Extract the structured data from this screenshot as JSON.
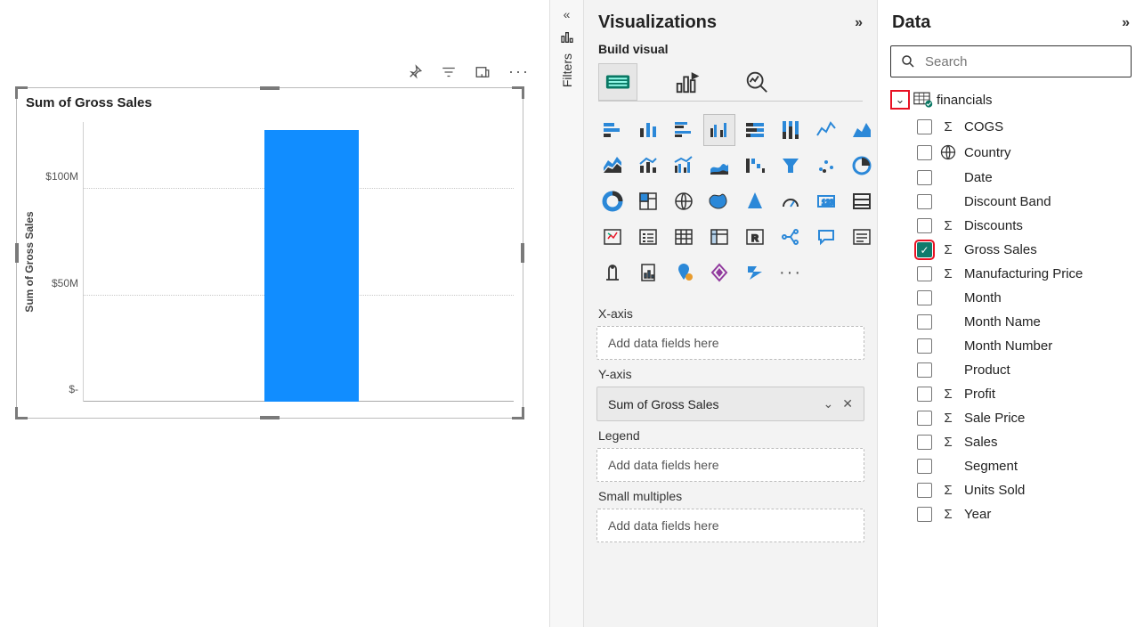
{
  "chart": {
    "title": "Sum of Gross Sales",
    "ylabel": "Sum of Gross Sales",
    "ticks": [
      "$100M",
      "$50M",
      "$-"
    ]
  },
  "chart_data": {
    "type": "bar",
    "title": "Sum of Gross Sales",
    "ylabel": "Sum of Gross Sales",
    "categories": [
      ""
    ],
    "values": [
      127000000
    ],
    "ylim": [
      0,
      130000000
    ],
    "y_ticks": [
      0,
      50000000,
      100000000
    ],
    "y_tick_labels": [
      "$-",
      "$50M",
      "$100M"
    ]
  },
  "filters": {
    "label": "Filters"
  },
  "viz": {
    "pane_title": "Visualizations",
    "build_label": "Build visual",
    "wells": {
      "x_label": "X-axis",
      "x_placeholder": "Add data fields here",
      "y_label": "Y-axis",
      "y_value": "Sum of Gross Sales",
      "legend_label": "Legend",
      "legend_placeholder": "Add data fields here",
      "sm_label": "Small multiples",
      "sm_placeholder": "Add data fields here"
    }
  },
  "data": {
    "pane_title": "Data",
    "search_placeholder": "Search",
    "table": "financials",
    "fields": [
      {
        "label": "COGS",
        "icon": "sigma",
        "checked": false
      },
      {
        "label": "Country",
        "icon": "globe",
        "checked": false
      },
      {
        "label": "Date",
        "icon": "none",
        "checked": false
      },
      {
        "label": "Discount Band",
        "icon": "none",
        "checked": false
      },
      {
        "label": "Discounts",
        "icon": "sigma",
        "checked": false
      },
      {
        "label": "Gross Sales",
        "icon": "sigma",
        "checked": true,
        "highlight": true
      },
      {
        "label": "Manufacturing Price",
        "icon": "sigma",
        "checked": false
      },
      {
        "label": "Month",
        "icon": "none",
        "checked": false
      },
      {
        "label": "Month Name",
        "icon": "none",
        "checked": false
      },
      {
        "label": "Month Number",
        "icon": "none",
        "checked": false
      },
      {
        "label": "Product",
        "icon": "none",
        "checked": false
      },
      {
        "label": "Profit",
        "icon": "sigma",
        "checked": false
      },
      {
        "label": "Sale Price",
        "icon": "sigma",
        "checked": false
      },
      {
        "label": "Sales",
        "icon": "sigma",
        "checked": false
      },
      {
        "label": "Segment",
        "icon": "none",
        "checked": false
      },
      {
        "label": "Units Sold",
        "icon": "sigma",
        "checked": false
      },
      {
        "label": "Year",
        "icon": "sigma",
        "checked": false
      }
    ]
  }
}
